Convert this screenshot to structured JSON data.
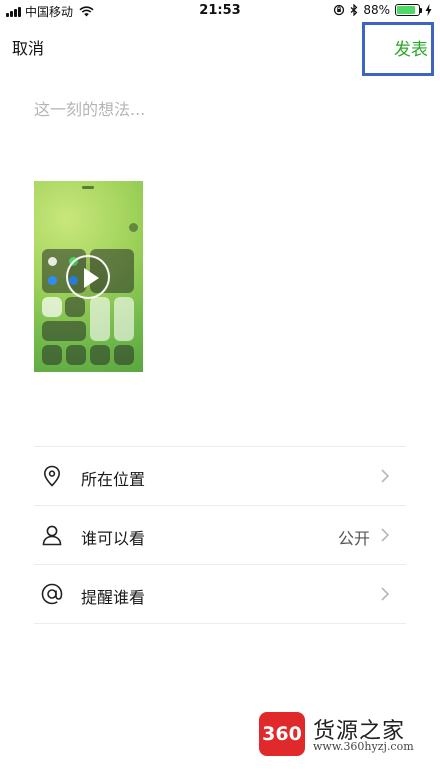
{
  "status_bar": {
    "carrier": "中国移动",
    "time": "21:53",
    "battery_percent": "88%",
    "battery_level": 0.88,
    "icons": [
      "signal-icon",
      "wifi-icon",
      "rotation-lock-icon",
      "bluetooth-icon",
      "battery-icon",
      "charging-icon"
    ]
  },
  "nav": {
    "cancel_label": "取消",
    "publish_label": "发表",
    "publish_color": "#2aa82a",
    "highlight_color": "#3e64c2"
  },
  "composer": {
    "placeholder": "这一刻的想法...",
    "value": ""
  },
  "media": {
    "type": "video",
    "icon": "play-icon"
  },
  "options": [
    {
      "label": "所在位置",
      "value": "",
      "icon": "location-pin-icon"
    },
    {
      "label": "谁可以看",
      "value": "公开",
      "icon": "person-icon"
    },
    {
      "label": "提醒谁看",
      "value": "",
      "icon": "at-sign-icon"
    }
  ],
  "watermark": {
    "logo_text": "360",
    "name": "货源之家",
    "url": "www.360hyzj.com",
    "logo_color": "#e0292a"
  }
}
